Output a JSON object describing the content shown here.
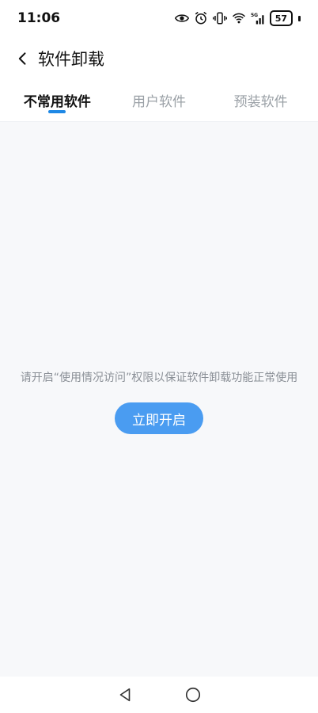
{
  "status_bar": {
    "time": "11:06",
    "battery_level": "57",
    "icons": [
      "eye-icon",
      "alarm-icon",
      "vibrate-icon",
      "wifi-icon",
      "5g-signal-icon",
      "battery-icon"
    ]
  },
  "header": {
    "back_icon": "chevron-left-icon",
    "title": "软件卸载"
  },
  "tabs": [
    {
      "label": "不常用软件",
      "active": true
    },
    {
      "label": "用户软件",
      "active": false
    },
    {
      "label": "预装软件",
      "active": false
    }
  ],
  "content": {
    "message": "请开启“使用情况访问”权限以保证软件卸载功能正常使用",
    "button_label": "立即开启"
  },
  "colors": {
    "accent": "#1e88e5",
    "button": "#4a9cf1",
    "background": "#f7f8fa",
    "muted_text": "#8a8f96"
  },
  "nav_bar": {
    "icons": [
      "back-triangle-icon",
      "home-circle-icon"
    ]
  }
}
